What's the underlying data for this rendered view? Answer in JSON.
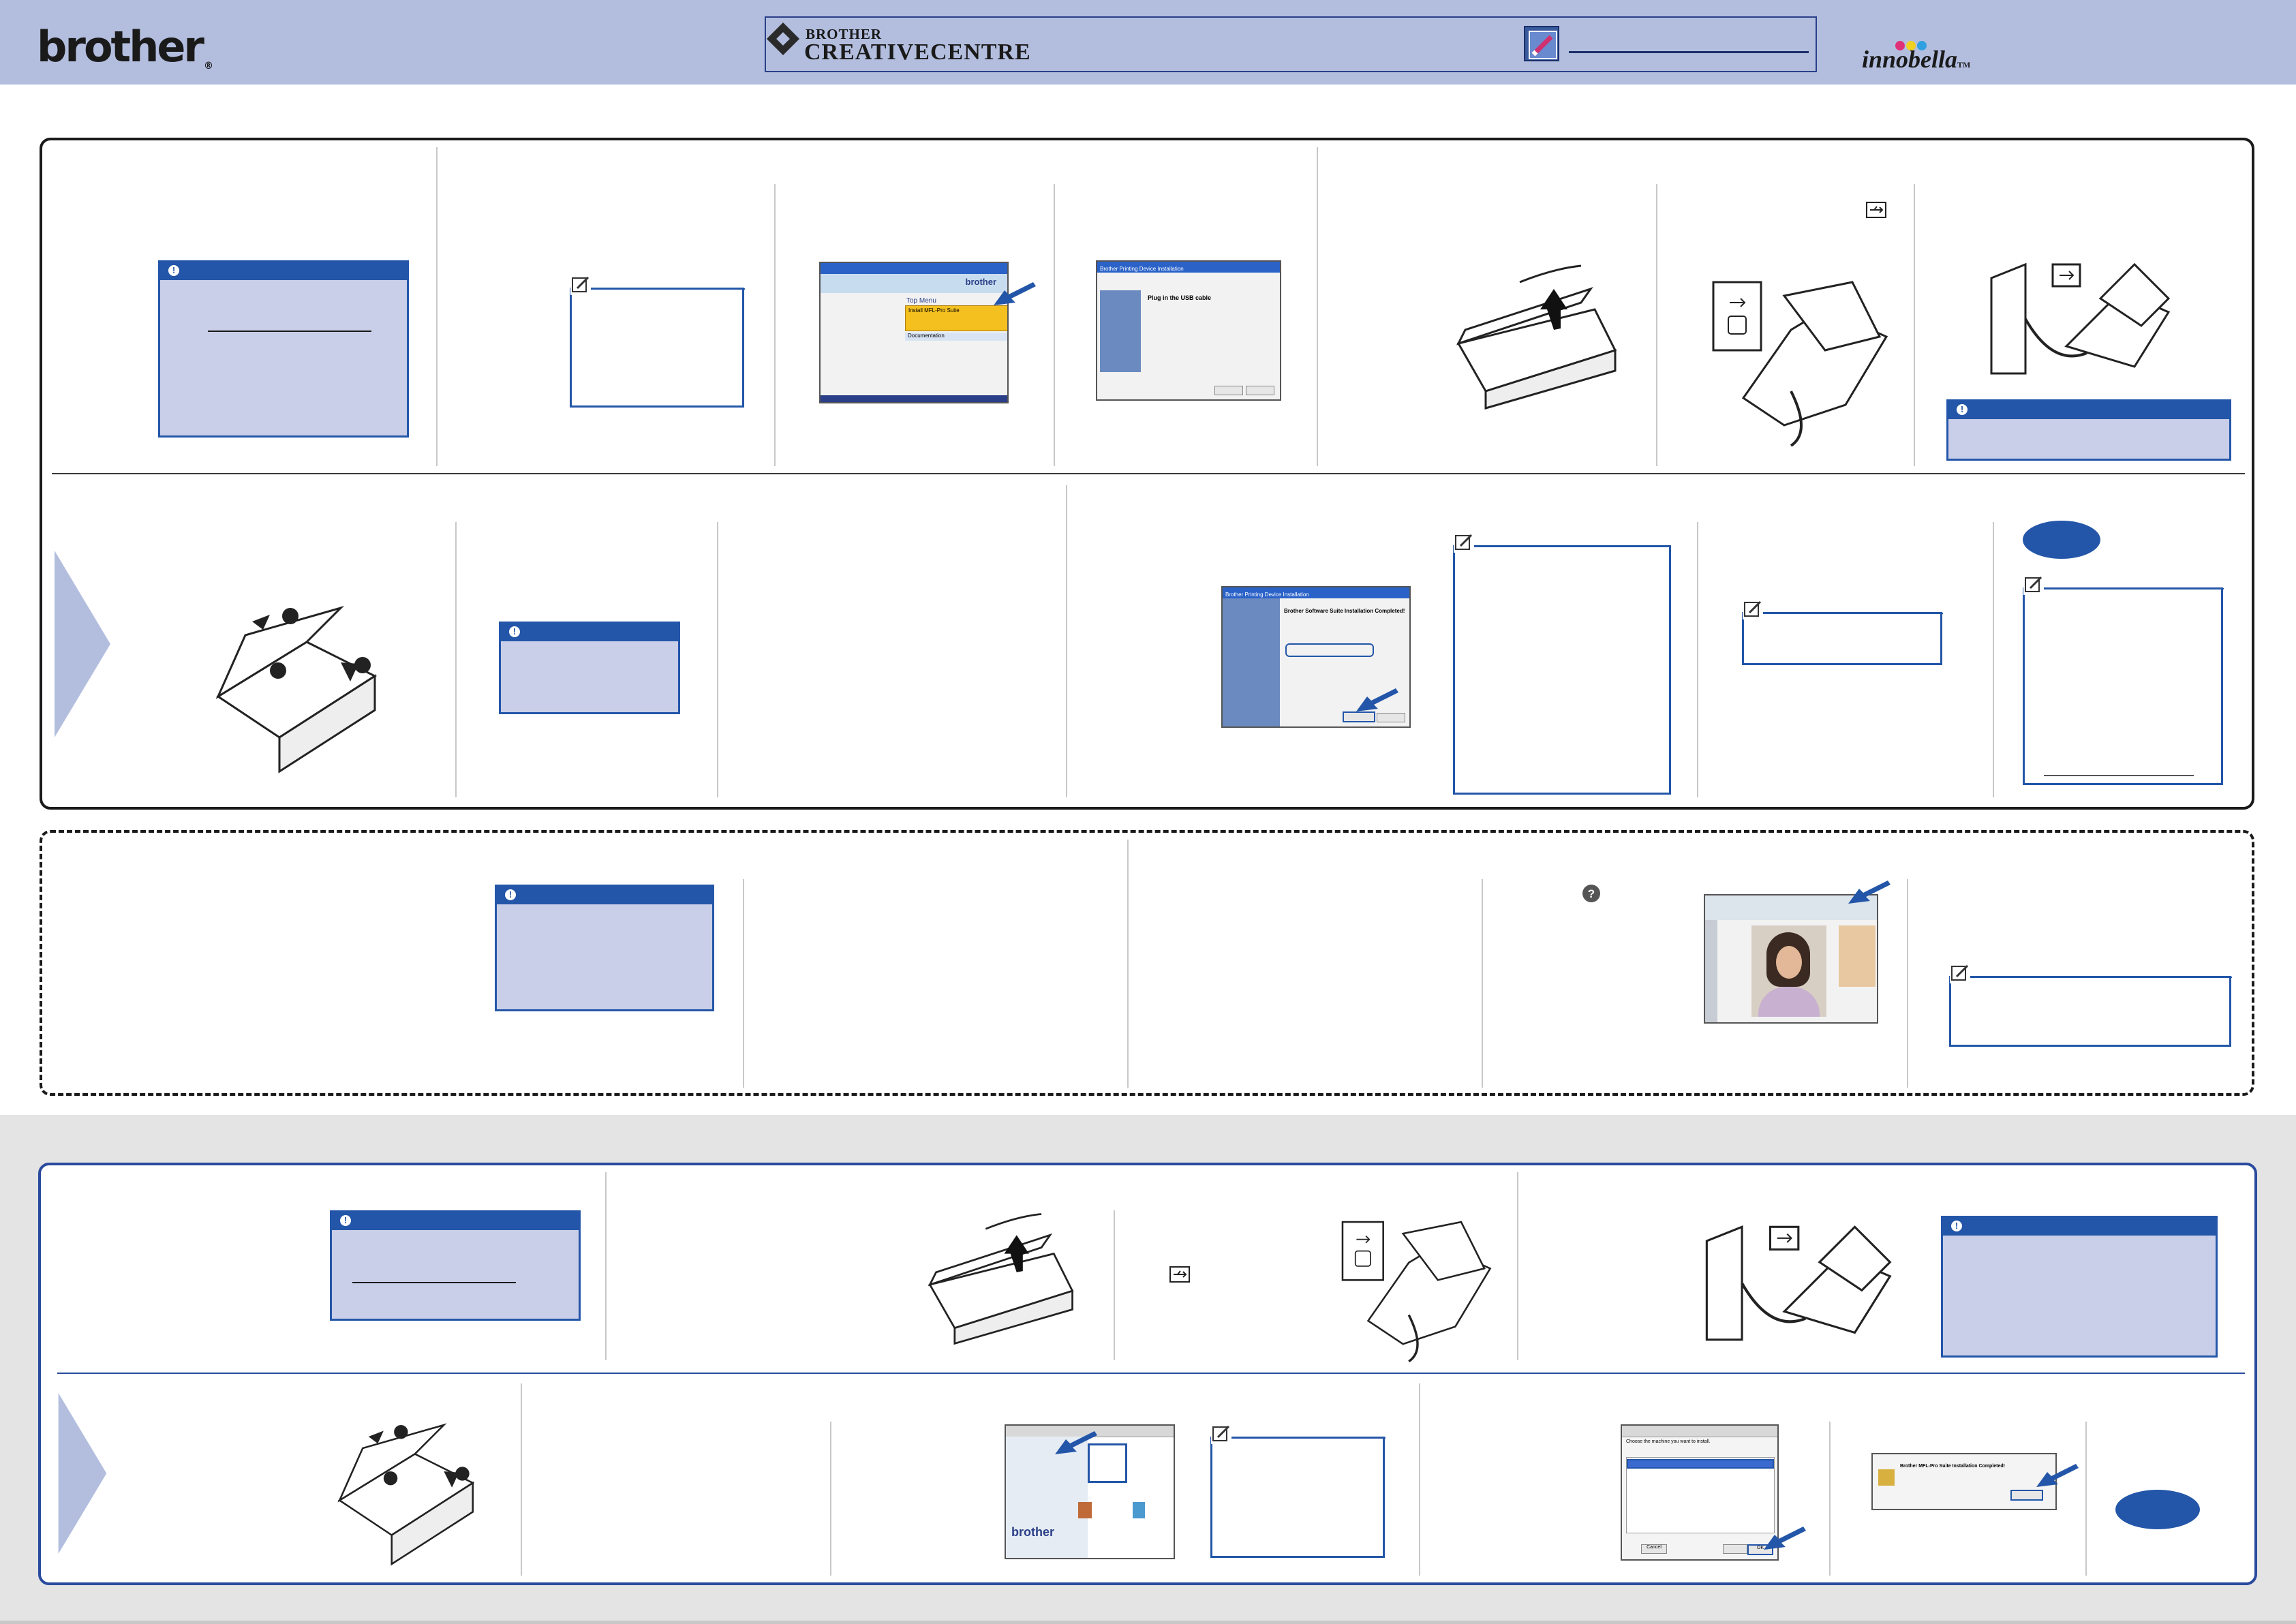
{
  "header": {
    "logo": "brother",
    "logo_mark": "®",
    "creative_centre_brother": "BROTHER",
    "creative_centre_name": "CREATIVECENTRE",
    "innobella": "innobella",
    "innobella_tm": "TM"
  },
  "colors": {
    "header_band": "#b3bedf",
    "accent_blue": "#2356a8",
    "caution_fill": "#c9cfe8",
    "grey_band": "#e4e4e4"
  },
  "screens": {
    "windows_top_menu_title": "Top Menu",
    "windows_top_menu_install": "Install MFL-Pro Suite",
    "windows_top_menu_documentation": "Documentation",
    "windows_top_menu_brand": "brother",
    "plug_usb_header": "Brother Printing Device Installation",
    "plug_usb_title": "Plug in the USB cable",
    "install_complete_header": "Brother Printing Device Installation",
    "install_complete_title": "Brother Software Suite Installation Completed!",
    "mac_brand": "brother",
    "mac_install_complete": "Brother MFL-Pro Suite Installation Completed!",
    "mac_choose_machine": "Choose the machine you want to install.",
    "mac_ok": "OK",
    "mac_cancel": "Cancel"
  },
  "icons": [
    "caution-icon",
    "note-icon",
    "pencil-icon",
    "usb-icon",
    "help-icon",
    "pointer-arrow-icon",
    "next-step-arrow-icon"
  ]
}
